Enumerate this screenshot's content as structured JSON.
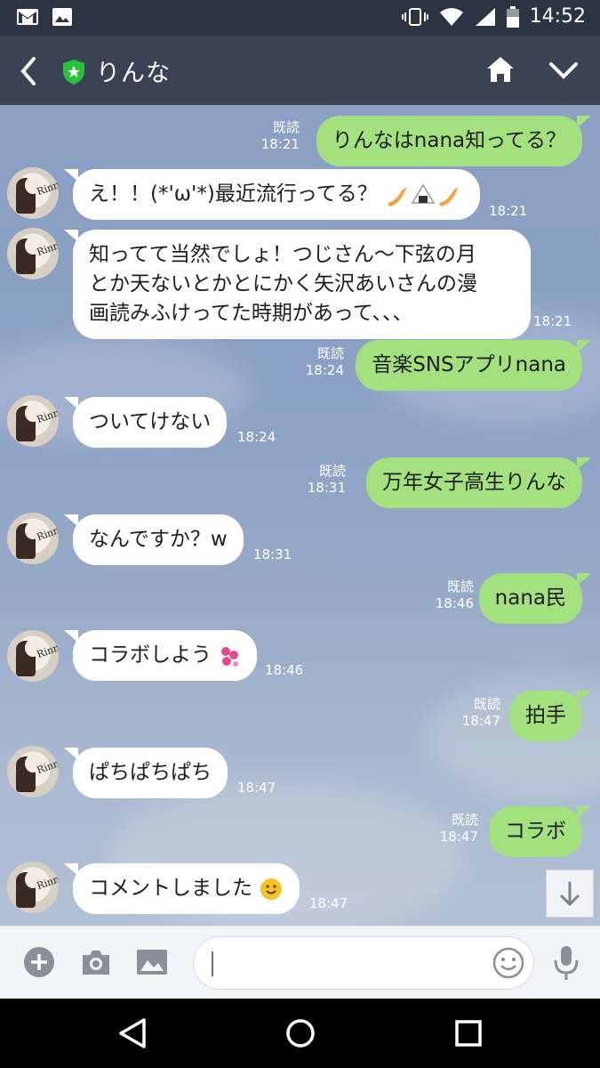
{
  "status_bar": {
    "time": "14:52"
  },
  "header": {
    "title": "りんな"
  },
  "messages": [
    {
      "dir": "out",
      "lines": [
        "りんなはnana知ってる？"
      ],
      "read": "既読",
      "time": "18:21"
    },
    {
      "dir": "in",
      "lines": [
        "え！！(*'ω'*)最近流行ってる？"
      ],
      "emoji": "shrimp-rice-ball-emojis",
      "time": "18:21"
    },
    {
      "dir": "in",
      "lines": [
        "知ってて当然でしょ！つじさん〜下弦の月",
        "とか天ないとかとにかく矢沢あいさんの漫",
        "画読みふけってた時期があって、、、"
      ],
      "time": "18:21"
    },
    {
      "dir": "out",
      "lines": [
        "音楽SNSアプリnana"
      ],
      "read": "既読",
      "time": "18:24"
    },
    {
      "dir": "in",
      "lines": [
        "ついてけない"
      ],
      "time": "18:24"
    },
    {
      "dir": "out",
      "lines": [
        "万年女子高生りんな"
      ],
      "read": "既読",
      "time": "18:31"
    },
    {
      "dir": "in",
      "lines": [
        "なんですか？w"
      ],
      "time": "18:31"
    },
    {
      "dir": "out",
      "lines": [
        "nana民"
      ],
      "read": "既読",
      "time": "18:46"
    },
    {
      "dir": "in",
      "lines": [
        "コラボしよう"
      ],
      "emoji": "hearts-emoji",
      "time": "18:46"
    },
    {
      "dir": "out",
      "lines": [
        "拍手"
      ],
      "read": "既読",
      "time": "18:47"
    },
    {
      "dir": "in",
      "lines": [
        "ぱちぱちぱち"
      ],
      "time": "18:47"
    },
    {
      "dir": "out",
      "lines": [
        "コラボ"
      ],
      "read": "既読",
      "time": "18:47"
    },
    {
      "dir": "in",
      "lines": [
        "コメントしました"
      ],
      "emoji": "smile-emoji",
      "time": "18:47"
    }
  ],
  "colors": {
    "incoming": "#ffffff",
    "outgoing": "#a3e07e",
    "header": "#3a4253",
    "status_bar": "#2c3342"
  }
}
